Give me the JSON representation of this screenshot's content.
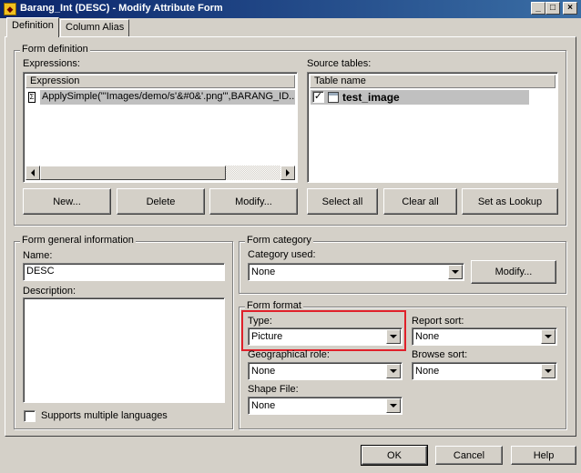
{
  "window": {
    "title": "Barang_Int (DESC) - Modify Attribute Form",
    "icon": "app-icon",
    "controls": [
      "minimize",
      "maximize",
      "close"
    ]
  },
  "tabs": [
    {
      "label": "Definition",
      "active": true
    },
    {
      "label": "Column Alias",
      "active": false
    }
  ],
  "form_definition": {
    "legend": "Form definition",
    "expressions_label": "Expressions:",
    "expressions_header": "Expression",
    "expressions": [
      {
        "icon": "expression-icon",
        "text": "ApplySimple(\"'Images/demo/s'&#0&'.png'\",BARANG_ID..."
      }
    ],
    "source_tables_label": "Source tables:",
    "source_header": "Table name",
    "source_tables": [
      {
        "checked": true,
        "icon": "table-icon",
        "name": "test_image"
      }
    ],
    "buttons": {
      "new": "New...",
      "delete": "Delete",
      "modify": "Modify...",
      "select_all": "Select all",
      "clear_all": "Clear all",
      "set_as_lookup": "Set as Lookup"
    }
  },
  "general_info": {
    "legend": "Form general information",
    "name_label": "Name:",
    "name_value": "DESC",
    "description_label": "Description:",
    "description_value": "",
    "multi_lang_label": "Supports multiple languages",
    "multi_lang_checked": false
  },
  "form_category": {
    "legend": "Form category",
    "category_label": "Category used:",
    "category_value": "None",
    "modify_button": "Modify..."
  },
  "form_format": {
    "legend": "Form format",
    "type_label": "Type:",
    "type_value": "Picture",
    "report_sort_label": "Report sort:",
    "report_sort_value": "None",
    "geo_role_label": "Geographical role:",
    "geo_role_value": "None",
    "browse_sort_label": "Browse sort:",
    "browse_sort_value": "None",
    "shape_file_label": "Shape File:",
    "shape_file_value": "None"
  },
  "footer": {
    "ok": "OK",
    "cancel": "Cancel",
    "help": "Help"
  },
  "colors": {
    "title_bar": "#0a246a",
    "dialog_face": "#d4d0c8",
    "highlight": "#e0202a",
    "selection": "#c0c0c0"
  }
}
